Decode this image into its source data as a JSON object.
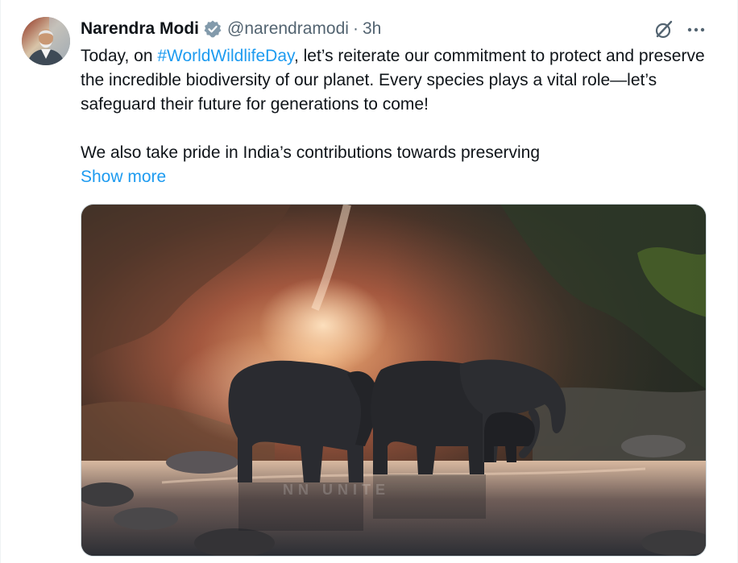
{
  "tweet": {
    "author": {
      "name": "Narendra Modi",
      "handle": "@narendramodi",
      "verified_icon": "verified-badge-icon",
      "avatar_icon": "profile-avatar"
    },
    "separator": "·",
    "time": "3h",
    "text": {
      "prefix": "Today, on ",
      "hashtag": "#WorldWildlifeDay",
      "suffix": ", let’s reiterate our commitment to protect and preserve the incredible biodiversity of our planet. Every species plays a vital role—let’s safeguard their future for generations to come!",
      "paragraph2": "We also take pride in India’s contributions towards preserving"
    },
    "show_more": "Show more",
    "media": {
      "type": "image",
      "watermark": "NN UNITE"
    }
  },
  "colors": {
    "link": "#1d9bf0",
    "text": "#0f1419",
    "muted": "#536471",
    "border": "#cfd9de"
  },
  "icons": {
    "grok": "grok-icon",
    "more": "more-options-icon"
  }
}
